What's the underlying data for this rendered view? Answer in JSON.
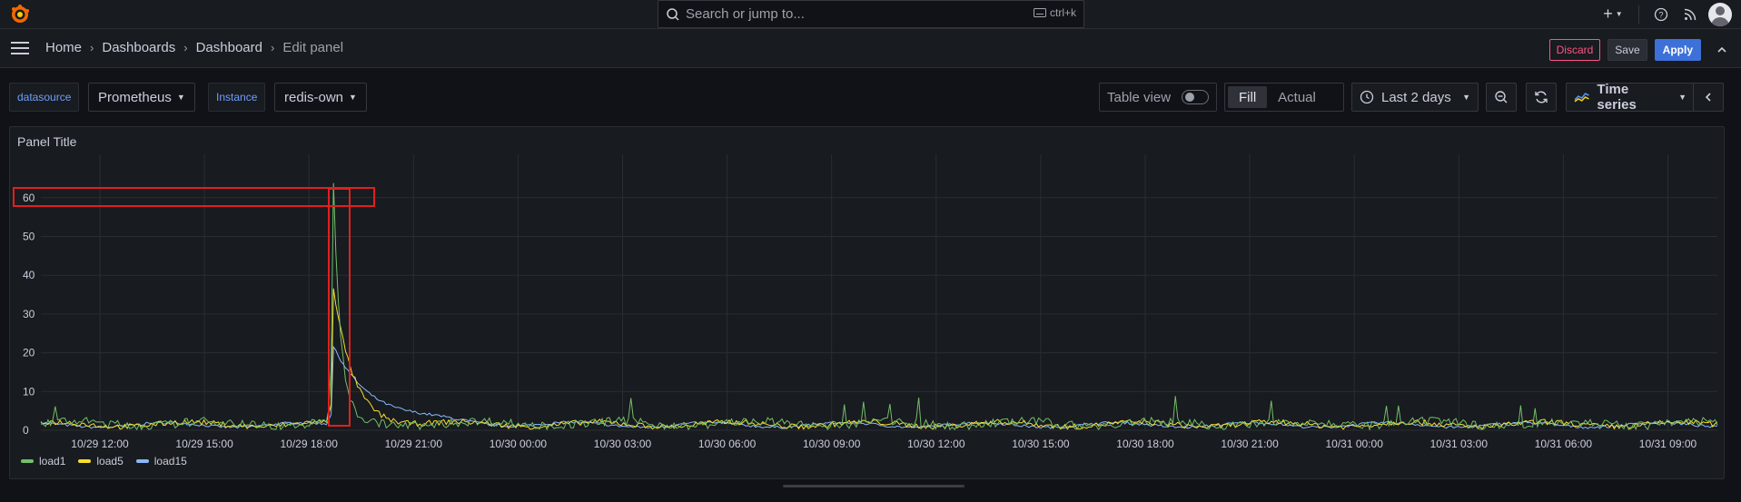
{
  "topbar": {
    "search_placeholder": "Search or jump to...",
    "shortcut": "ctrl+k",
    "icons": [
      "grafana-logo-icon",
      "search-icon",
      "keyboard-icon",
      "plus-icon",
      "help-icon",
      "news-icon",
      "user-avatar"
    ]
  },
  "breadcrumb": [
    "Home",
    "Dashboards",
    "Dashboard",
    "Edit panel"
  ],
  "actions": {
    "discard": "Discard",
    "save": "Save",
    "apply": "Apply"
  },
  "variables": [
    {
      "label": "datasource",
      "value": "Prometheus"
    },
    {
      "label": "Instance",
      "value": "redis-own"
    }
  ],
  "toolbar": {
    "table_view": "Table view",
    "table_view_on": false,
    "fill": "Fill",
    "actual": "Actual",
    "time_range": "Last 2 days",
    "visualization": "Time series"
  },
  "panel": {
    "title": "Panel Title"
  },
  "colors": {
    "load1": "#73bf69",
    "load5": "#fade2a",
    "load15": "#8ab8ff",
    "apply": "#3d71d9",
    "discard": "#ff5286",
    "highlight": "#e0201e"
  },
  "chart_data": {
    "type": "line",
    "title": "Panel Title",
    "ylim": [
      0,
      65
    ],
    "y_ticks": [
      "0",
      "10",
      "20",
      "30",
      "40",
      "50",
      "60"
    ],
    "x_ticks": [
      "10/29 12:00",
      "10/29 15:00",
      "10/29 18:00",
      "10/29 21:00",
      "10/30 00:00",
      "10/30 03:00",
      "10/30 06:00",
      "10/30 09:00",
      "10/30 12:00",
      "10/30 15:00",
      "10/30 18:00",
      "10/30 21:00",
      "10/31 00:00",
      "10/31 03:00",
      "10/31 06:00",
      "10/31 09:00"
    ],
    "legend_position": "bottom-left",
    "grid": true,
    "series": [
      {
        "name": "load1",
        "baseline": 1.5,
        "peak": 61
      },
      {
        "name": "load5",
        "baseline": 1.4,
        "peak": 35
      },
      {
        "name": "load15",
        "baseline": 1.3,
        "peak": 20
      }
    ],
    "peak_time": "10/29 19:20"
  }
}
